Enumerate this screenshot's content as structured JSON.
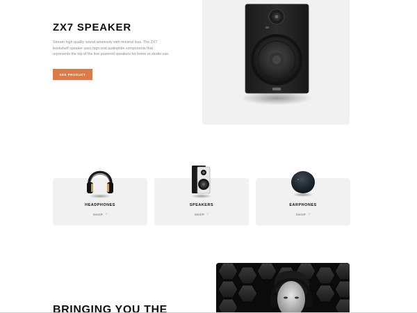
{
  "hero": {
    "title": "ZX7 SPEAKER",
    "description": "Stream high quality sound wirelessly with minimal loss. The ZX7 bookshelf speaker uses high-end audiophile components that represents the top of the line powered speakers for home or studio use.",
    "button_label": "SEE PRODUCT",
    "image": "zx7-speaker-image",
    "accent": "#d87d4a"
  },
  "categories": [
    {
      "name": "HEADPHONES",
      "shop_label": "SHOP",
      "icon": "headphones-image"
    },
    {
      "name": "SPEAKERS",
      "shop_label": "SHOP",
      "icon": "speaker-image"
    },
    {
      "name": "EARPHONES",
      "shop_label": "SHOP",
      "icon": "earphones-image"
    }
  ],
  "about": {
    "title": "BRINGING YOU THE",
    "image": "man-with-headphones-photo"
  },
  "colors": {
    "accent": "#d87d4a",
    "card_bg": "#f1f1f1",
    "text_dark": "#101010",
    "text_muted": "#8d8d8d"
  }
}
